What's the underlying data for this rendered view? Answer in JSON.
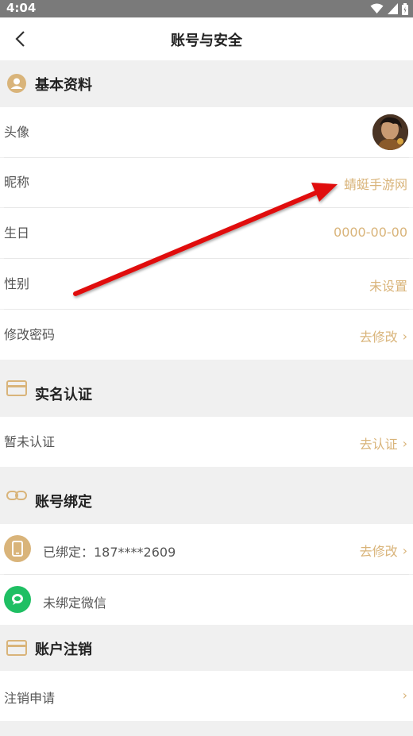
{
  "status_bar": {
    "time": "4:04"
  },
  "header": {
    "title": "账号与安全"
  },
  "sections": {
    "basic": {
      "title": "基本资料"
    },
    "realname": {
      "title": "实名认证"
    },
    "binding": {
      "title": "账号绑定"
    },
    "cancel": {
      "title": "账户注销"
    }
  },
  "basic_rows": {
    "avatar": {
      "label": "头像"
    },
    "nickname": {
      "label": "昵称",
      "value": "蜻蜓手游网"
    },
    "birthday": {
      "label": "生日",
      "value": "0000-00-00"
    },
    "gender": {
      "label": "性别",
      "value": "未设置"
    },
    "password": {
      "label": "修改密码",
      "value": "去修改"
    }
  },
  "realname_row": {
    "label": "暂未认证",
    "value": "去认证"
  },
  "binding_rows": {
    "phone": {
      "label": "已绑定：187****2609",
      "value": "去修改"
    },
    "wechat": {
      "label": "未绑定微信"
    }
  },
  "cancel_row": {
    "label": "注销申请"
  },
  "colors": {
    "accent": "#d9b47a",
    "wechat": "#1fbf63",
    "annotation_arrow": "#e01010"
  }
}
